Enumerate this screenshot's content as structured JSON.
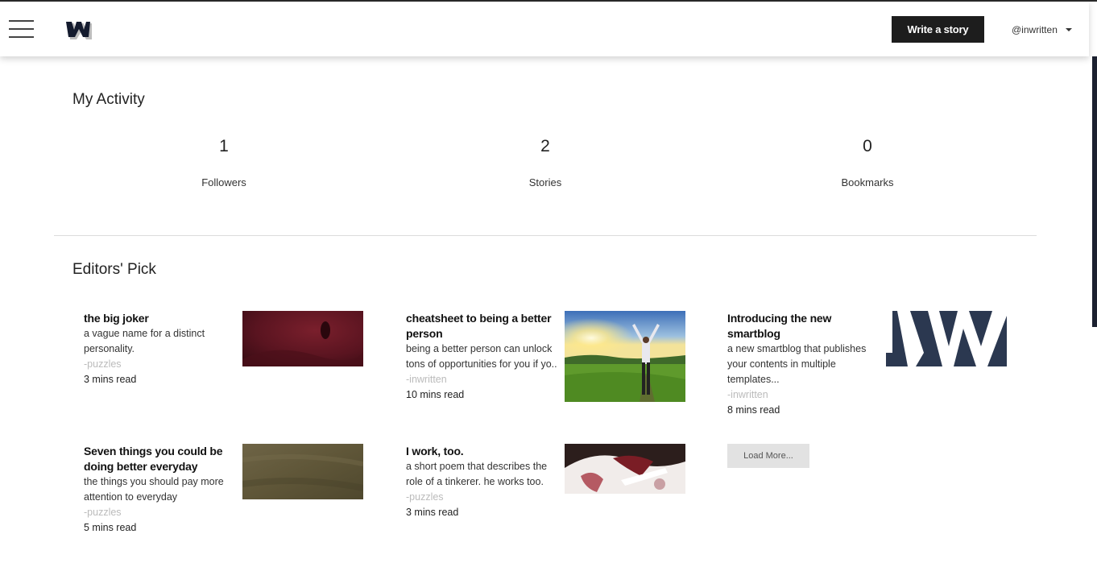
{
  "header": {
    "menu_icon": "hamburger-menu-icon",
    "logo_icon": "w-logo-icon",
    "write_label": "Write a story",
    "username": "@inwritten",
    "dropdown_icon": "caret-down-icon"
  },
  "activity": {
    "title": "My Activity",
    "stats": [
      {
        "value": "1",
        "label": "Followers"
      },
      {
        "value": "2",
        "label": "Stories"
      },
      {
        "value": "0",
        "label": "Bookmarks"
      }
    ]
  },
  "editors_pick": {
    "title": "Editors' Pick",
    "cards": [
      {
        "title": "the big joker",
        "desc": "a vague name for a distinct personality.",
        "author": "-puzzles",
        "read": "3 mins read",
        "image": "red-fabric-closeup"
      },
      {
        "title": "cheatsheet to being a better person",
        "desc": "being a better person can unlock tons of opportunities for you if yo..",
        "author": "-inwritten",
        "read": "10 mins read",
        "image": "man-arms-raised-sunrise-field"
      },
      {
        "title": "Introducing the new smartblog",
        "desc": "a new smartblog that publishes your contents in multiple templates...",
        "author": "-inwritten",
        "read": "8 mins read",
        "image": "iw-logo-banner"
      },
      {
        "title": "Seven things you could be doing better everyday",
        "desc": "the things you should pay more attention to everyday",
        "author": "-puzzles",
        "read": "5 mins read",
        "image": "olive-texture"
      },
      {
        "title": "I work, too.",
        "desc": "a short poem that describes the role of a tinkerer. he works too.",
        "author": "-puzzles",
        "read": "3 mins read",
        "image": "tinkerer-closeup"
      }
    ],
    "load_more_label": "Load More..."
  },
  "colors": {
    "button_dark": "#1d1d1d",
    "author_gray": "#bbbbbb",
    "load_more_bg": "#e2e2e2",
    "right_edge_bar": "#1c2130"
  }
}
